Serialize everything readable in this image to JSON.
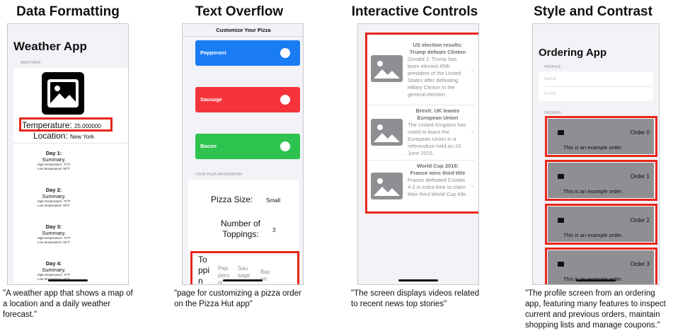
{
  "panels": {
    "data_formatting": {
      "title": "Data Formatting",
      "caption": "\"A weather app that shows a map of a location and a daily weather forecast.\"",
      "app_title": "Weather App",
      "section_label": "WEATHER",
      "icon": "image-icon",
      "temperature_label": "Temperature:",
      "temperature_value": "25.000000",
      "location_label": "Location:",
      "location_value": "New York",
      "days": [
        {
          "title": "Day 1:",
          "summary": "Summary.",
          "high": "High temperature: 70°F",
          "low": "Low temperature: 60°F"
        },
        {
          "title": "Day 2:",
          "summary": "Summary.",
          "high": "High temperature: 70°F",
          "low": "Low temperature: 60°F"
        },
        {
          "title": "Day 3:",
          "summary": "Summary.",
          "high": "High temperature: 70°F",
          "low": "Low temperature: 60°F"
        },
        {
          "title": "Day 4:",
          "summary": "Summary.",
          "high": "High temperature: 70°F",
          "low": "Low temperature: 60°F"
        }
      ]
    },
    "text_overflow": {
      "title": "Text Overflow",
      "caption": "\"page for customizing a pizza order on the Pizza Hut app\"",
      "header": "Customize Your Pizza",
      "toppings": [
        {
          "label": "Pepperoni",
          "color": "#1a7cf5"
        },
        {
          "label": "Sausage",
          "color": "#f5333b"
        },
        {
          "label": "Bacon",
          "color": "#2ec24e"
        }
      ],
      "info_label": "YOUR PIZZA INFORMATION",
      "size_label": "Pizza Size:",
      "size_value": "Small",
      "num_label": "Number of Toppings:",
      "num_value": "3",
      "top_label": "Toppin",
      "top_values": [
        "Pepperoni",
        "Sausage",
        "Bacon"
      ]
    },
    "interactive_controls": {
      "title": "Interactive Controls",
      "caption": "\"The screen displays videos related to recent news top stories\"",
      "stories": [
        {
          "title": "US election results: Trump defeats Clinton",
          "body": "Donald J. Trump has been elected 45th president of the United States after defeating Hillary Clinton in the general election.",
          "icon": "image-icon"
        },
        {
          "title": "Brexit: UK leaves European Union",
          "body": "The United Kingdom has voted to leave the European Union in a referendum held on 23 June 2016.",
          "icon": "image-icon"
        },
        {
          "title": "World Cup 2018: France wins third title",
          "body": "France defeated Croatia 4-2 in extra time to claim their third World Cup title.",
          "icon": "image-icon"
        }
      ]
    },
    "style_contrast": {
      "title": "Style and Contrast",
      "caption": "\"The profile screen from an ordering app, featuring many features to inspect current and previous orders, maintain shopping lists and manage coupons.\"",
      "app_title": "Ordering App",
      "profile_label": "PROFILE",
      "name_placeholder": "Name",
      "email_placeholder": "Email",
      "orders_label": "ORDERS",
      "orders": [
        {
          "label": "Order 0",
          "desc": "This is an example order."
        },
        {
          "label": "Order 1",
          "desc": "This is an example order."
        },
        {
          "label": "Order 2",
          "desc": "This is an example order."
        },
        {
          "label": "Order 3",
          "desc": "This is an example order."
        }
      ]
    }
  },
  "colors": {
    "highlight": "#e8261b",
    "secondary_text": "#8e8e93",
    "order_card": "#8e8e93"
  }
}
